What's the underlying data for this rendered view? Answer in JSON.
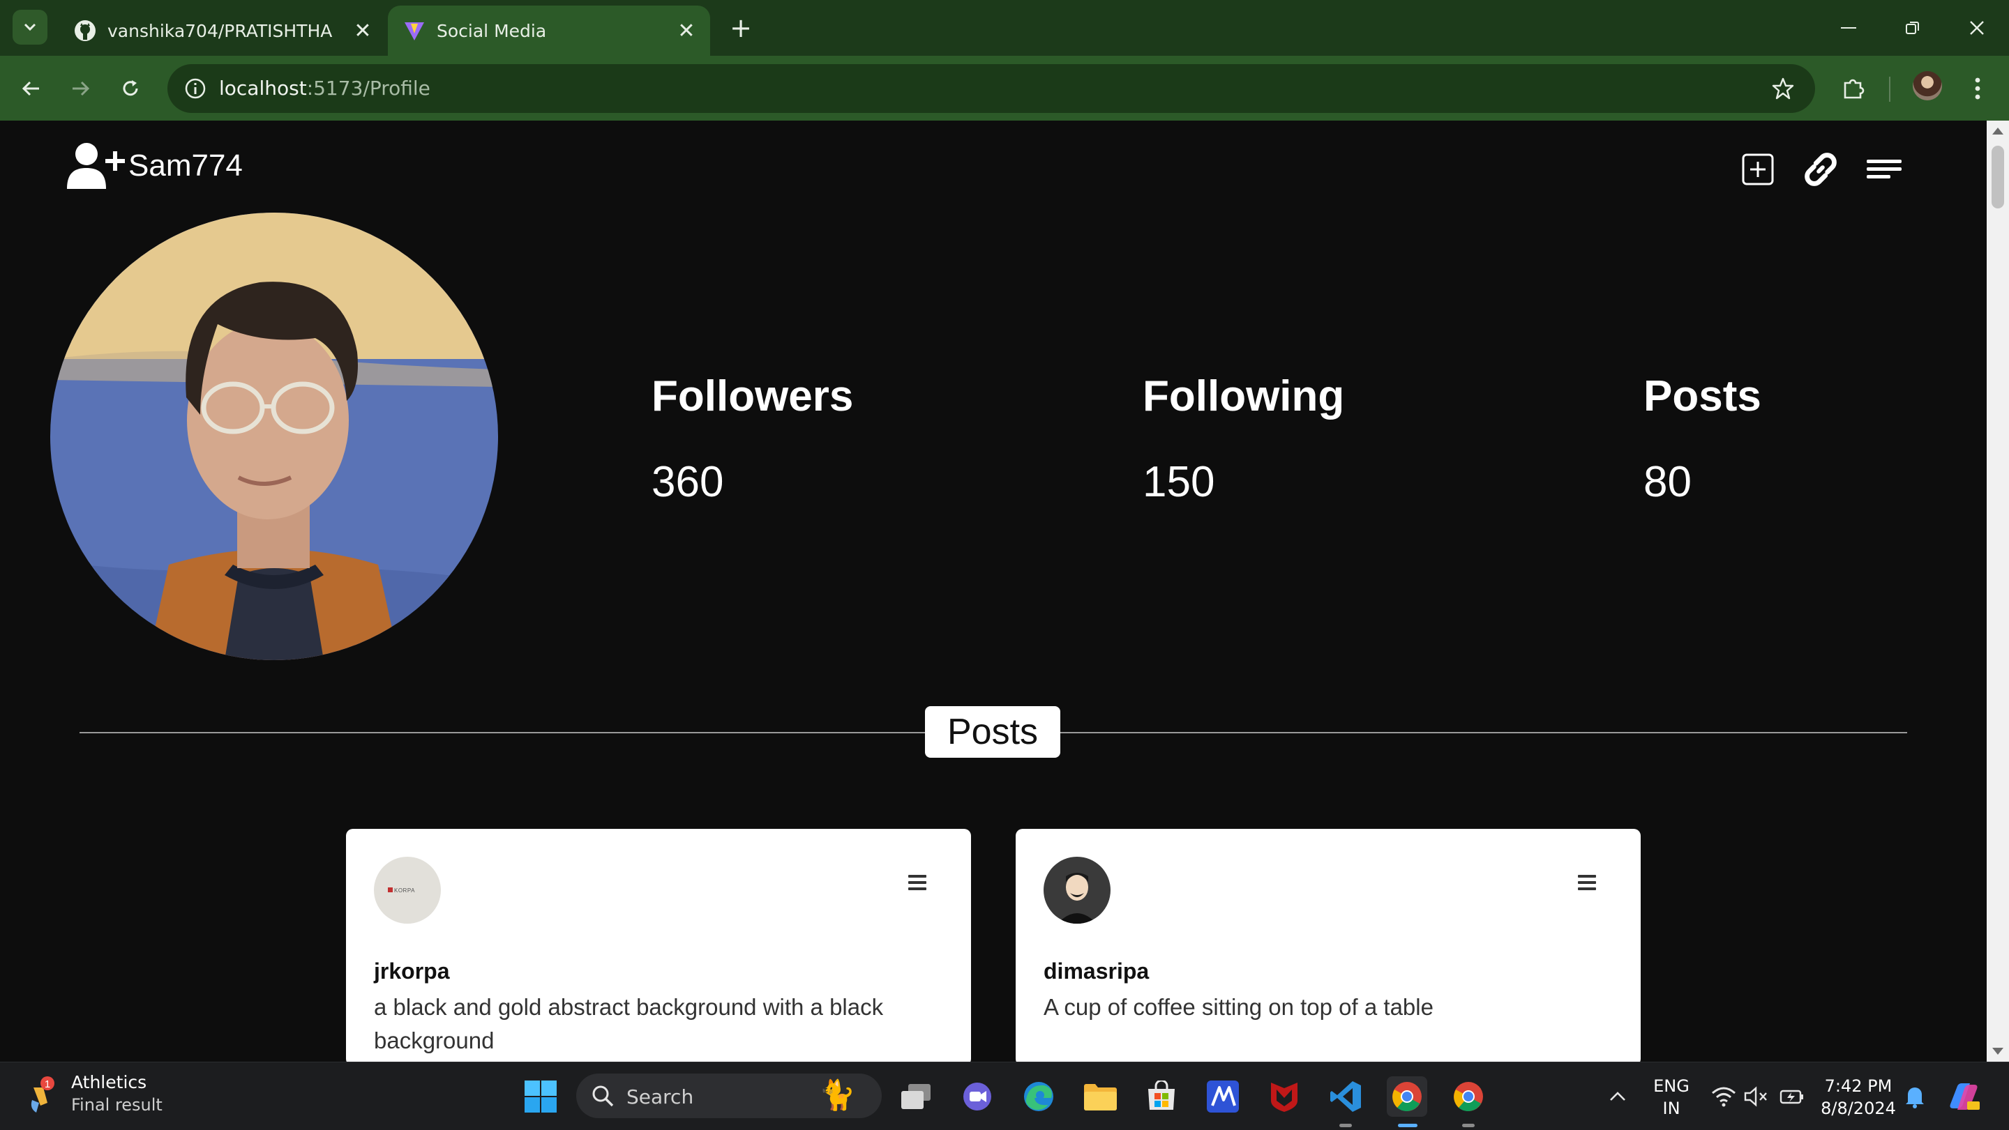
{
  "browser": {
    "tabs": [
      {
        "title": "vanshika704/PRATISHTHA",
        "active": false
      },
      {
        "title": "Social Media",
        "active": true
      }
    ],
    "url_host": "localhost",
    "url_path": ":5173/Profile"
  },
  "header": {
    "username": "Sam774",
    "icons": [
      "add-user-icon",
      "add-post-icon",
      "link-icon",
      "menu-icon"
    ]
  },
  "profile": {
    "stats": [
      {
        "label": "Followers",
        "value": "360"
      },
      {
        "label": "Following",
        "value": "150"
      },
      {
        "label": "Posts",
        "value": "80"
      }
    ]
  },
  "posts_section": {
    "title": "Posts",
    "cards": [
      {
        "username": "jrkorpa",
        "caption": "a black and gold abstract background with a black background",
        "avatar_text": "KORPA"
      },
      {
        "username": "dimasripa",
        "caption": "A cup of coffee sitting on top of a table"
      }
    ]
  },
  "taskbar": {
    "widget_title": "Athletics",
    "widget_subtitle": "Final result",
    "widget_badge": "1",
    "search_label": "Search",
    "lang_line1": "ENG",
    "lang_line2": "IN",
    "time": "7:42 PM",
    "date": "8/8/2024"
  },
  "colors": {
    "tabstrip": "#1c3a1a",
    "toolbar": "#2c5a28",
    "page_bg": "#0d0d0d",
    "card_bg": "#ffffff"
  }
}
